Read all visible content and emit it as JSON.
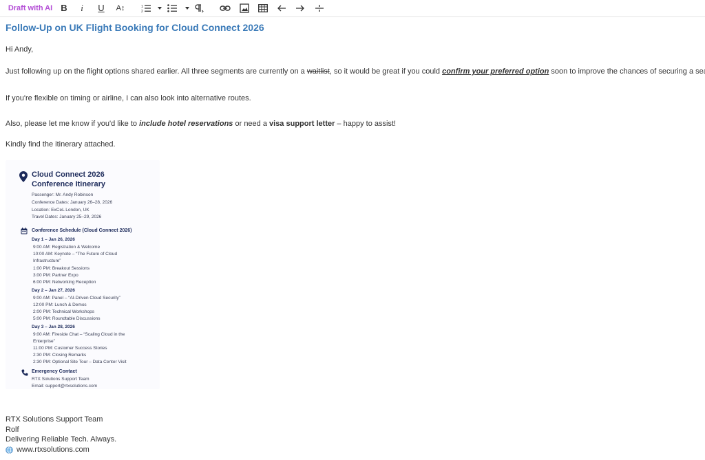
{
  "toolbar": {
    "draft_ai": "Draft with AI",
    "bold": "B",
    "italic": "i",
    "underline": "U",
    "text_size": "A↕"
  },
  "email": {
    "subject": "Follow-Up on UK Flight Booking for Cloud Connect 2026",
    "greeting": "Hi Andy,",
    "p1_a": "Just following up on the flight options shared earlier. All three segments are currently on a ",
    "p1_strike": "waitlist",
    "p1_b": ", so it would be great if you could ",
    "p1_emph": "confirm your preferred option",
    "p1_c": " soon to improve the chances of securing a seat.",
    "p2": "If you're flexible on timing or airline, I can also look into alternative routes.",
    "p3_a": "Also, please let me know if you'd like to ",
    "p3_emph": "include hotel reservations",
    "p3_b": " or need a ",
    "p3_bold": "visa support letter",
    "p3_c": " – happy to assist!",
    "p4": "Kindly find the itinerary attached."
  },
  "itinerary": {
    "title_line1": "Cloud Connect 2026",
    "title_line2": "Conference Itinerary",
    "passenger": "Passenger: Mr. Andy Robinson",
    "conf_dates": "Conference Dates: January 26–28, 2026",
    "location": "Location: ExCeL London, UK",
    "travel_dates": "Travel Dates: January 25–29, 2026",
    "schedule_heading": "Conference Schedule (Cloud Connect 2026)",
    "day1": "Day 1 – Jan 26, 2026",
    "d1_1": "9:00 AM: Registration  & Welcome",
    "d1_2": "10:00 AM: Keynote – “The Future of Cloud",
    "d1_2b": "Infrastructure”",
    "d1_3": "1:00 PM: Breakout Sessions",
    "d1_4": "3:00 PM: Partner Expo",
    "d1_5": "6:00 PM: Networking Reception",
    "day2": "Day 2 – Jan 27, 2026",
    "d2_1": "9:00 AM: Panel – “AI-Driven Cloud Security”",
    "d2_2": "12:00 PM: Lunch & Demos",
    "d2_3": "2:00 PM: Technical Workshops",
    "d2_4": "5:00 PM: Roundtable Discussions",
    "day3": "Day 3 – Jan 28, 2026",
    "d3_1": "9:00 AM: Fireside Chat – “Scaling Cloud in the",
    "d3_1b": "Enterprise”",
    "d3_2": "11:00 PM:  Customer Success Stories",
    "d3_3": "2:30 PM: Closing Remarks",
    "d3_4": "2:30 PM: Optional Site Tour – Data Center Visit",
    "emergency_heading": "Emergency Contact",
    "em_1": "RTX Solutions Support Team",
    "em_2": "Email: support@rtxsolutions.com"
  },
  "signature": {
    "team": "RTX Solutions Support Team",
    "name": "Rolf",
    "tagline": "Delivering Reliable Tech. Always.",
    "website": "www.rtxsolutions.com"
  },
  "colors": {
    "subject": "#3a7ab8",
    "ai_accent": "#b44fd6",
    "itinerary_navy": "#1c2a5a"
  }
}
